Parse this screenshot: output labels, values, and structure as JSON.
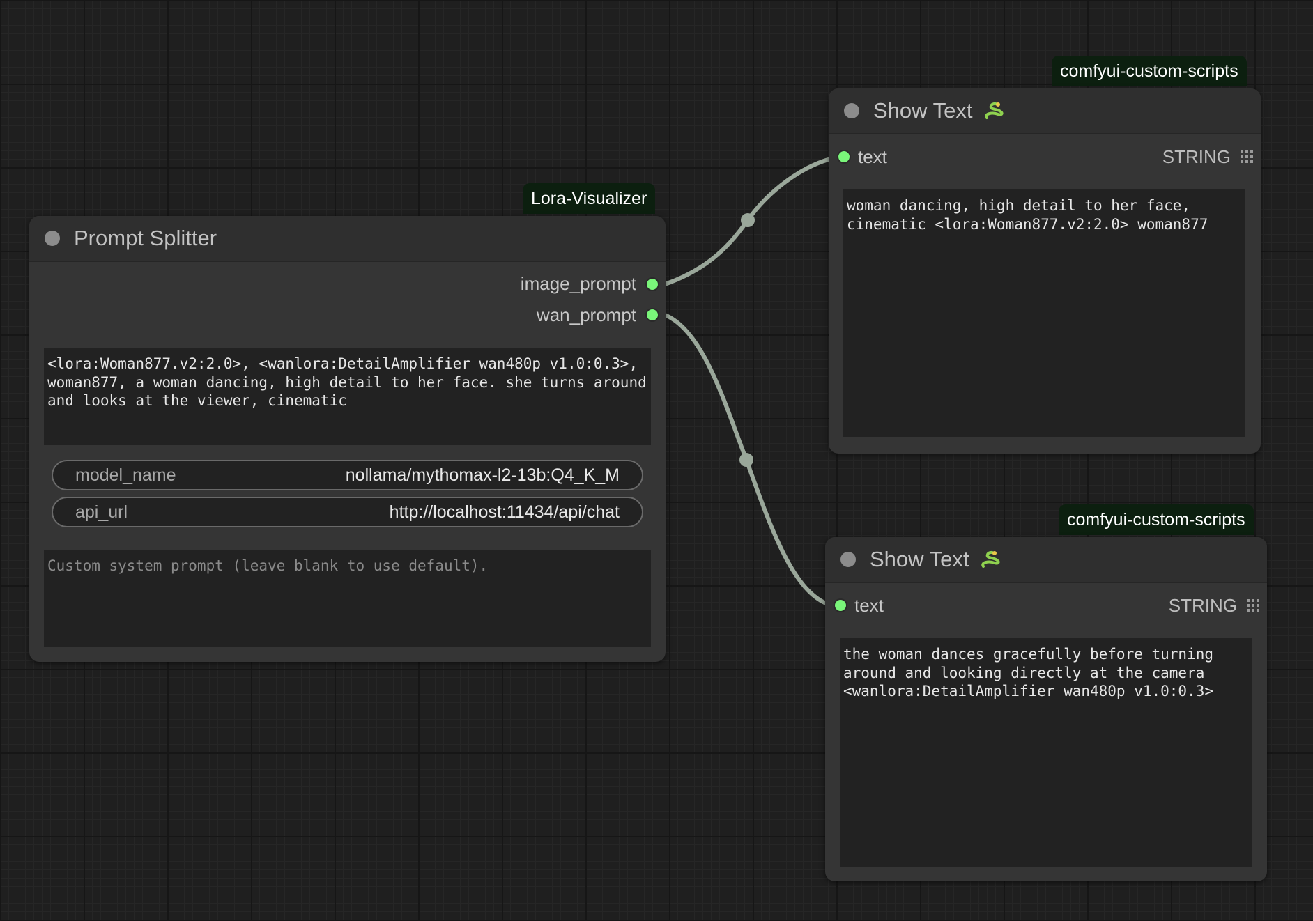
{
  "nodes": {
    "prompt_splitter": {
      "source": "Lora-Visualizer",
      "title": "Prompt Splitter",
      "outputs": [
        "image_prompt",
        "wan_prompt"
      ],
      "prompt_text": "<lora:Woman877.v2:2.0>, <wanlora:DetailAmplifier wan480p v1.0:0.3>, woman877, a woman dancing, high detail to her face. she turns around and looks at the viewer, cinematic",
      "widgets": {
        "model_name": {
          "label": "model_name",
          "value": "nollama/mythomax-l2-13b:Q4_K_M"
        },
        "api_url": {
          "label": "api_url",
          "value": "http://localhost:11434/api/chat"
        }
      },
      "system_prompt_placeholder": "Custom system prompt (leave blank to use default)."
    },
    "show_text_1": {
      "source": "comfyui-custom-scripts",
      "title": "Show Text",
      "input_label": "text",
      "output_type": "STRING",
      "text": "woman dancing, high detail to her face, cinematic <lora:Woman877.v2:2.0> woman877"
    },
    "show_text_2": {
      "source": "comfyui-custom-scripts",
      "title": "Show Text",
      "input_label": "text",
      "output_type": "STRING",
      "text": "the woman dances gracefully before turning around and looking directly at the camera <wanlora:DetailAmplifier wan480p v1.0:0.3>"
    }
  },
  "icons": {
    "title_emoji": "snake-icon",
    "output_menu": "grid-icon"
  },
  "colors": {
    "slot": "#7af57a",
    "link": "#9aa79a",
    "source_tag": "#0c1f0f"
  }
}
